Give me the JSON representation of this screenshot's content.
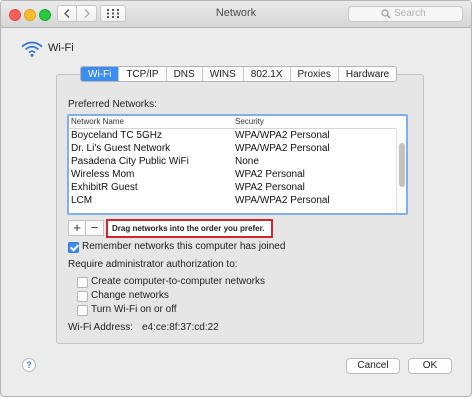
{
  "window": {
    "title": "Network",
    "search_placeholder": "Search"
  },
  "header": {
    "title": "Wi-Fi"
  },
  "tabs": [
    {
      "label": "Wi-Fi",
      "active": true
    },
    {
      "label": "TCP/IP",
      "active": false
    },
    {
      "label": "DNS",
      "active": false
    },
    {
      "label": "WINS",
      "active": false
    },
    {
      "label": "802.1X",
      "active": false
    },
    {
      "label": "Proxies",
      "active": false
    },
    {
      "label": "Hardware",
      "active": false
    }
  ],
  "preferred": {
    "label": "Preferred Networks:",
    "columns": [
      "Network Name",
      "Security"
    ],
    "rows": [
      {
        "name": "Boyceland TC 5GHz",
        "security": "WPA/WPA2 Personal"
      },
      {
        "name": "Dr. Li's Guest Network",
        "security": "WPA/WPA2 Personal"
      },
      {
        "name": "Pasadena City Public WiFi",
        "security": "None"
      },
      {
        "name": "Wireless Mom",
        "security": "WPA2 Personal"
      },
      {
        "name": "ExhibitR Guest",
        "security": "WPA2 Personal"
      },
      {
        "name": "LCM",
        "security": "WPA/WPA2 Personal"
      }
    ],
    "add_label": "+",
    "remove_label": "−",
    "hint": "Drag networks into the order you prefer."
  },
  "options": {
    "remember": {
      "label": "Remember networks this computer has joined",
      "checked": true
    },
    "admin_label": "Require administrator authorization to:",
    "admin_items": [
      {
        "label": "Create computer-to-computer networks",
        "checked": false
      },
      {
        "label": "Change networks",
        "checked": false
      },
      {
        "label": "Turn Wi-Fi on or off",
        "checked": false
      }
    ]
  },
  "wifi_address": {
    "label": "Wi-Fi Address:",
    "value": "e4:ce:8f:37:cd:22"
  },
  "footer": {
    "help_label": "?",
    "cancel_label": "Cancel",
    "ok_label": "OK"
  },
  "colors": {
    "accent": "#3b8ef1",
    "callout_border": "#d0262c"
  }
}
